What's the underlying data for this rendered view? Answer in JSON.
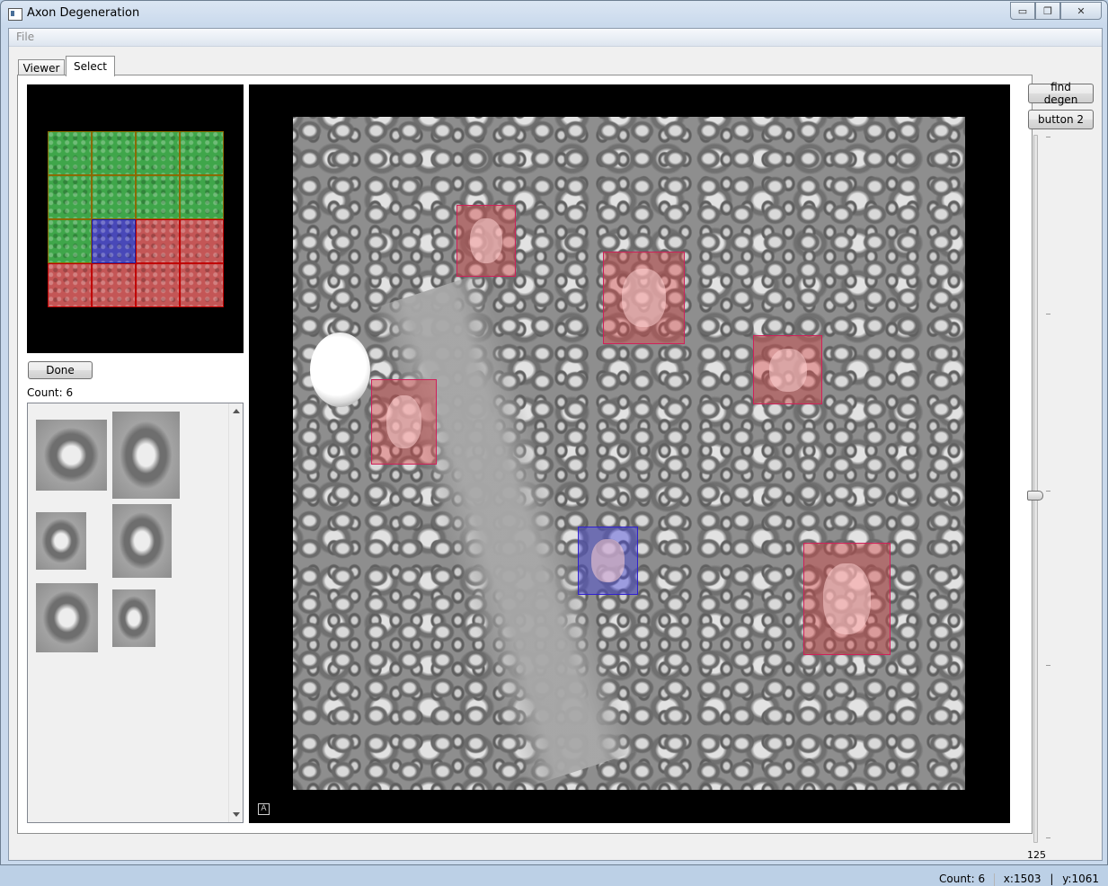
{
  "window": {
    "title": "Axon Degeneration",
    "controls": {
      "minimize": "▭",
      "maximize": "❐",
      "close": "✕"
    }
  },
  "menu": {
    "file": "File"
  },
  "tabs": [
    {
      "label": "Viewer"
    },
    {
      "label": "Select"
    }
  ],
  "active_tab": "Select",
  "overview_grid": {
    "rows": 4,
    "cols": 4,
    "cells": [
      "green",
      "green",
      "green",
      "green",
      "green",
      "green",
      "green",
      "green",
      "green",
      "blue",
      "red",
      "red",
      "red",
      "red",
      "red",
      "red"
    ],
    "colors": {
      "green": "#3fa64a",
      "red": "#c45656",
      "blue": "#4848b8"
    }
  },
  "left_panel": {
    "done_label": "Done",
    "count_label": "Count: 6"
  },
  "main_view": {
    "corner_icon": "A",
    "selections": [
      {
        "color": "red"
      },
      {
        "color": "red"
      },
      {
        "color": "red"
      },
      {
        "color": "red"
      },
      {
        "color": "blue"
      },
      {
        "color": "red"
      }
    ]
  },
  "right_panel": {
    "find_degen_label": "find degen",
    "button2_label": "button 2",
    "slider_value": "125"
  },
  "status": {
    "count": "Count: 6",
    "x": "x:1503",
    "y": "y:1061"
  },
  "colors": {
    "selection_red": "#d0205a",
    "selection_blue": "#3020d0",
    "title_bg": "#c9d9ec"
  }
}
